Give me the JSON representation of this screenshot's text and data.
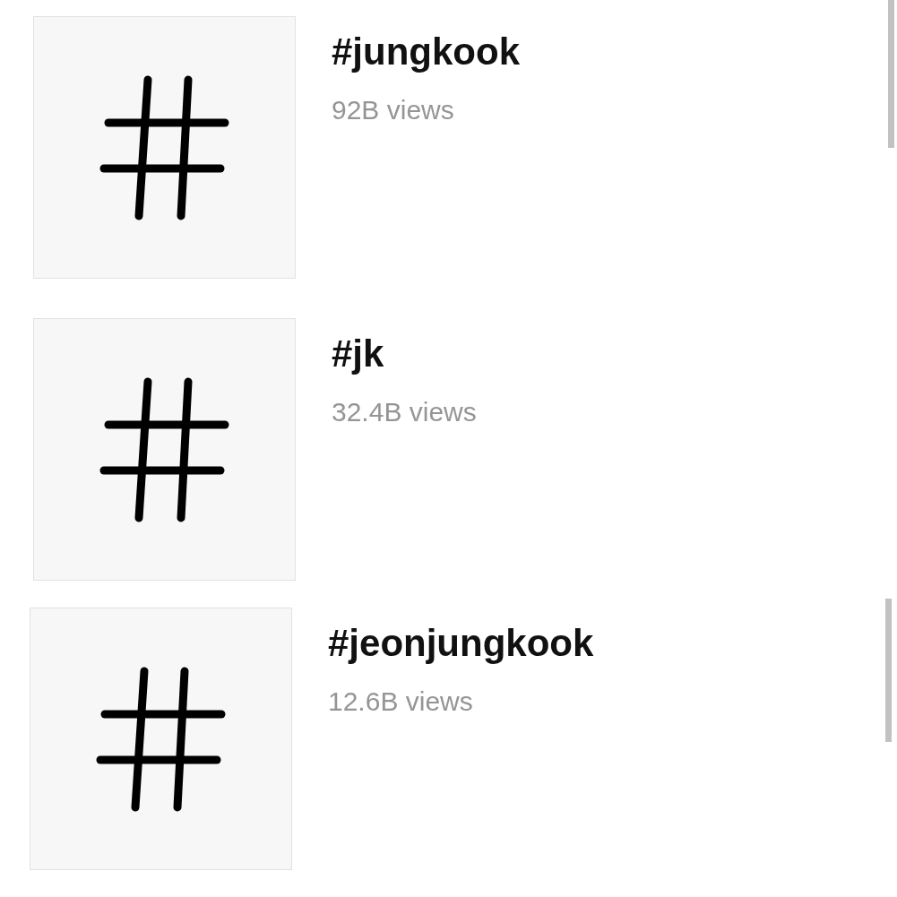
{
  "hashtags": [
    {
      "tag": "#jungkook",
      "views": "92B views"
    },
    {
      "tag": "#jk",
      "views": "32.4B views"
    },
    {
      "tag": "#jeonjungkook",
      "views": "12.6B views"
    }
  ]
}
